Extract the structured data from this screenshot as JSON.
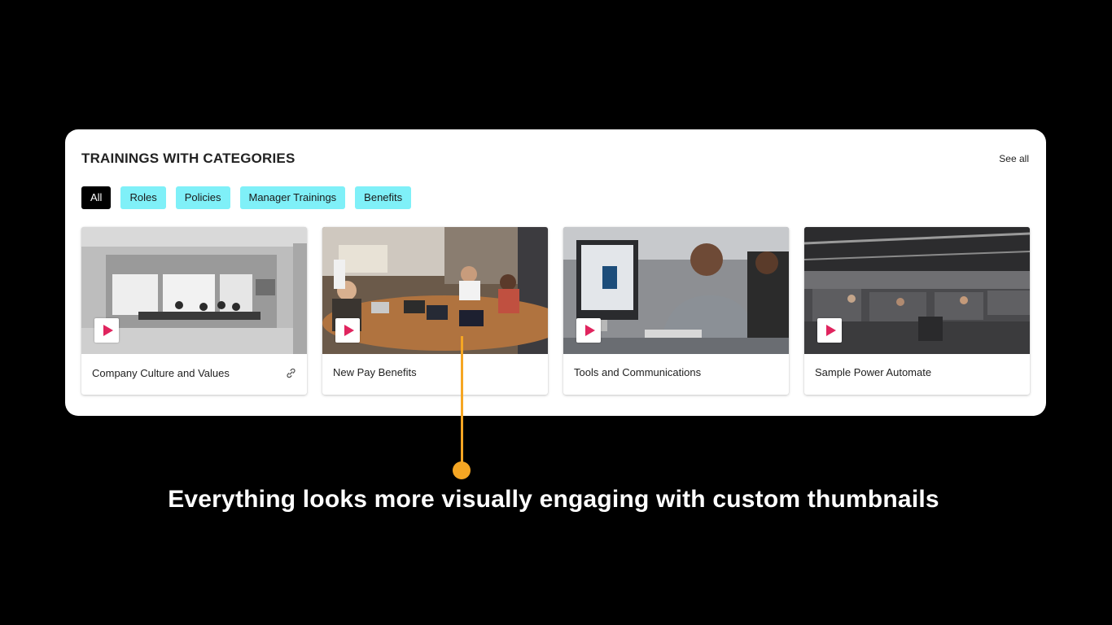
{
  "panel": {
    "title": "TRAININGS WITH CATEGORIES",
    "see_all": "See all"
  },
  "filters": [
    {
      "label": "All",
      "active": true
    },
    {
      "label": "Roles",
      "active": false
    },
    {
      "label": "Policies",
      "active": false
    },
    {
      "label": "Manager Trainings",
      "active": false
    },
    {
      "label": "Benefits",
      "active": false
    }
  ],
  "cards": [
    {
      "title": "Company Culture and Values",
      "thumbnail": "glass-meeting-room-photo",
      "play_icon": "play-icon",
      "link_icon": "link-icon"
    },
    {
      "title": "New Pay Benefits",
      "thumbnail": "conference-table-meeting-photo",
      "play_icon": "play-icon"
    },
    {
      "title": "Tools and Communications",
      "thumbnail": "person-at-computer-photo",
      "play_icon": "play-icon"
    },
    {
      "title": "Sample Power Automate",
      "thumbnail": "open-plan-office-photo",
      "play_icon": "play-icon"
    }
  ],
  "callout": {
    "caption": "Everything looks more visually engaging with custom thumbnails",
    "color": "#f5a623"
  },
  "colors": {
    "chip_background": "#7ff0f8",
    "chip_active_background": "#000000",
    "play_accent": "#e0245e"
  }
}
